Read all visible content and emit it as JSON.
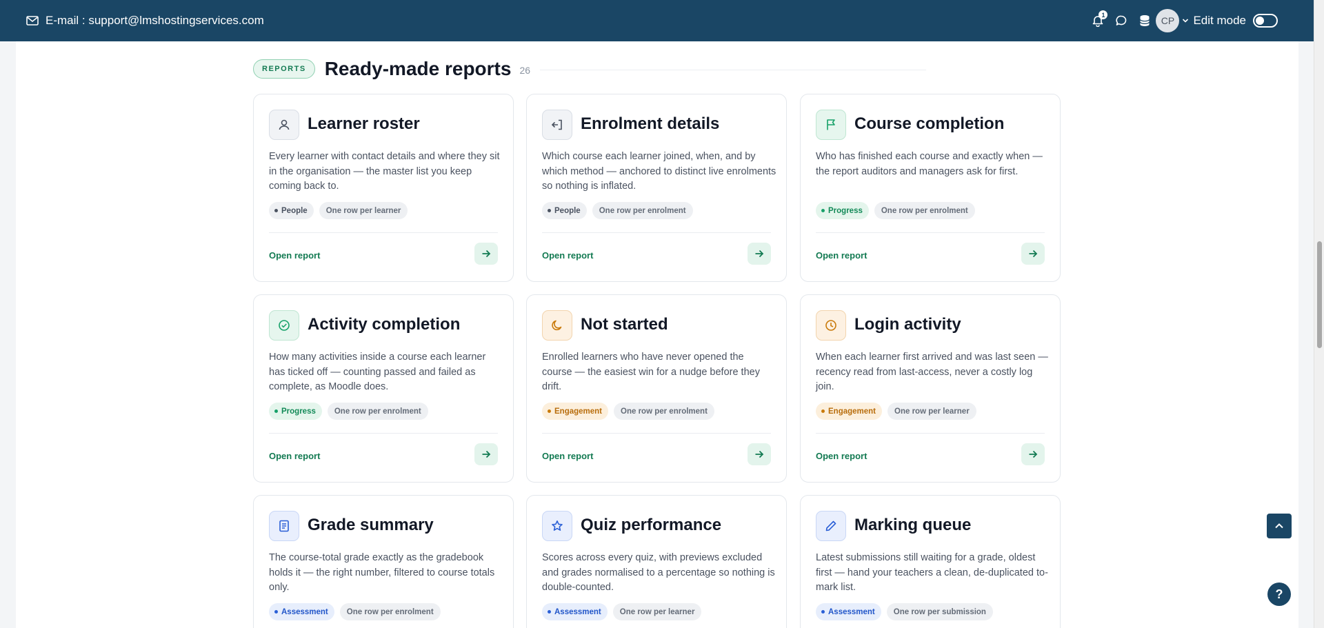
{
  "topbar": {
    "email_text": "E-mail : support@lmshostingservices.com",
    "notification_count": "1",
    "avatar_initials": "CP",
    "edit_mode_label": "Edit mode",
    "edit_mode_on": false,
    "bar_color": "#1a4665"
  },
  "section": {
    "pill": "REPORTS",
    "title": "Ready-made reports",
    "count": "26"
  },
  "cards": [
    {
      "title": "Learner roster",
      "icon": "person-icon",
      "desc": "Every learner with contact details and where they sit in the organisation — the master list you keep coming back to.",
      "category": "People",
      "grain": "One row per learner",
      "cta": "Open report"
    },
    {
      "title": "Enrolment details",
      "icon": "enrol-icon",
      "desc": "Which course each learner joined, when, and by which method — anchored to distinct live enrolments so nothing is inflated.",
      "category": "People",
      "grain": "One row per enrolment",
      "cta": "Open report"
    },
    {
      "title": "Course completion",
      "icon": "flag-icon",
      "desc": "Who has finished each course and exactly when — the report auditors and managers ask for first.",
      "category": "Progress",
      "grain": "One row per enrolment",
      "cta": "Open report"
    },
    {
      "title": "Activity completion",
      "icon": "check-circle-icon",
      "desc": "How many activities inside a course each learner has ticked off — counting passed and failed as complete, as Moodle does.",
      "category": "Progress",
      "grain": "One row per enrolment",
      "cta": "Open report"
    },
    {
      "title": "Not started",
      "icon": "moon-icon",
      "desc": "Enrolled learners who have never opened the course — the easiest win for a nudge before they drift.",
      "category": "Engagement",
      "grain": "One row per enrolment",
      "cta": "Open report"
    },
    {
      "title": "Login activity",
      "icon": "clock-icon",
      "desc": "When each learner first arrived and was last seen — recency read from last-access, never a costly log join.",
      "category": "Engagement",
      "grain": "One row per learner",
      "cta": "Open report"
    },
    {
      "title": "Grade summary",
      "icon": "document-icon",
      "desc": "The course-total grade exactly as the gradebook holds it — the right number, filtered to course totals only.",
      "category": "Assessment",
      "grain": "One row per enrolment",
      "cta": "Open report"
    },
    {
      "title": "Quiz performance",
      "icon": "star-icon",
      "desc": "Scores across every quiz, with previews excluded and grades normalised to a percentage so nothing is double-counted.",
      "category": "Assessment",
      "grain": "One row per learner",
      "cta": "Open report"
    },
    {
      "title": "Marking queue",
      "icon": "pencil-icon",
      "desc": "Latest submissions still waiting for a grade, oldest first — hand your teachers a clean, de-duplicated to-mark list.",
      "category": "Assessment",
      "grain": "One row per submission",
      "cta": "Open report"
    }
  ],
  "floating": {
    "help_label": "?"
  }
}
